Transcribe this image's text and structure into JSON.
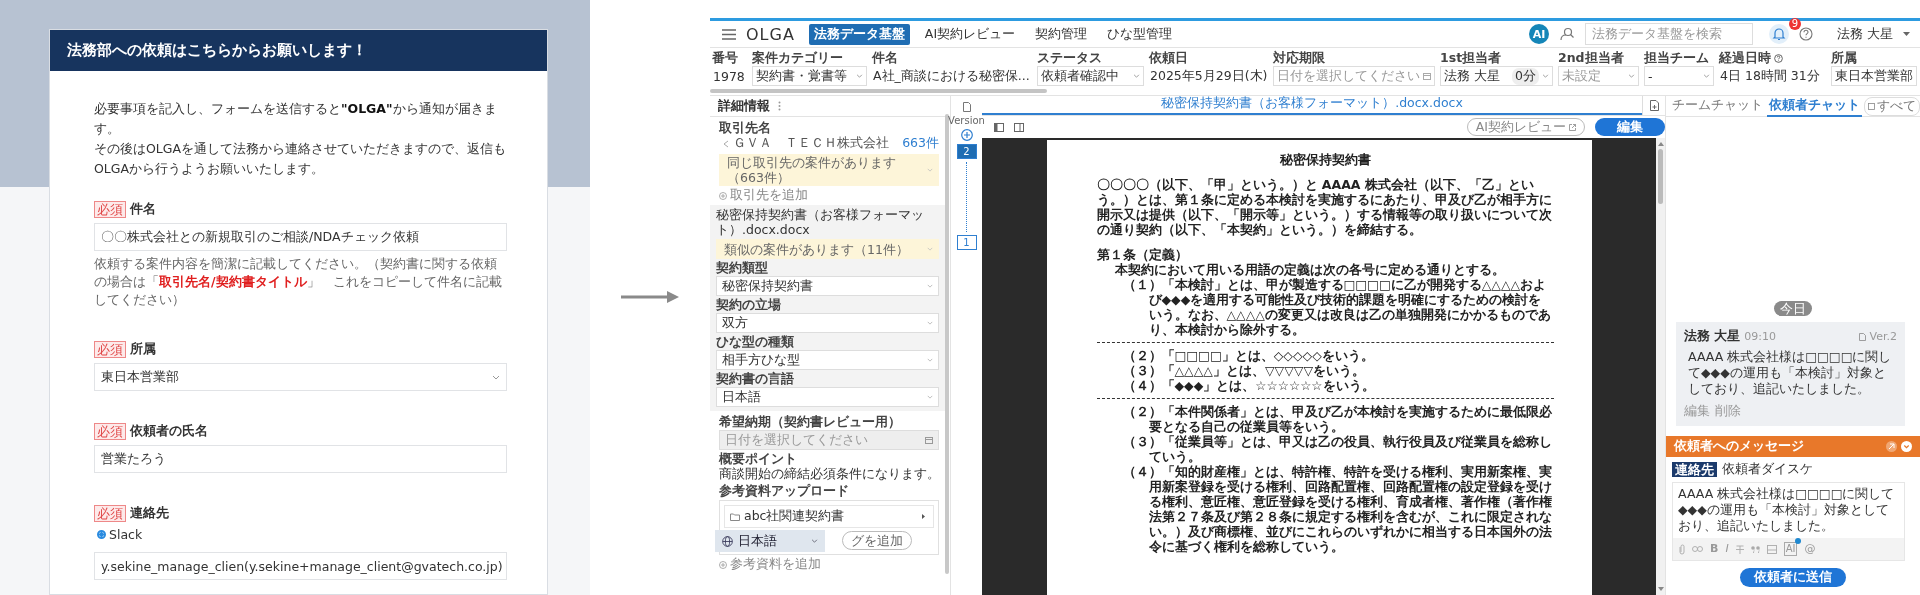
{
  "form": {
    "title": "法務部への依頼はこちらからお願いします！",
    "intro": [
      "必要事項を記入し、フォームを送信すると**\"OLGA\"**から通知が届きます。",
      "その後はOLGAを通して法務から連絡させていただきますので、返信もOLGAから行うようお願いいたします。"
    ],
    "fields": [
      {
        "kind": "text",
        "badge": "必須",
        "label": "件名",
        "value": "〇〇株式会社との新規取引のご相談/NDAチェック依頼",
        "help": "依頼する案件内容を簡潔に記載してください。（契約書に関する依頼の場合は「**取引先名/契約書タイトル**」　これをコピーして件名に記載してください）"
      },
      {
        "kind": "select",
        "badge": "必須",
        "label": "所属",
        "value": "東日本営業部"
      },
      {
        "kind": "text",
        "badge": "必須",
        "label": "依頼者の氏名",
        "value": "営業たろう"
      },
      {
        "kind": "select",
        "badge": "必須",
        "label": "連絡先",
        "options": [
          {
            "label": "Slack",
            "selected": true
          }
        ],
        "value": "y.sekine_manage_clien(y.sekine+manage_client@gvatech.co.jp)"
      }
    ]
  },
  "app": {
    "logo": "OLGA",
    "nav_tabs": [
      {
        "label": "法務データ基盤",
        "selected": true
      },
      {
        "label": "AI契約レビュー",
        "selected": false
      },
      {
        "label": "契約管理",
        "selected": false
      },
      {
        "label": "ひな型管理",
        "selected": false
      }
    ],
    "ai_badge": "AI",
    "search": {
      "placeholder": "法務データ基盤を検索"
    },
    "notification_count": "9",
    "user": "法務 大星",
    "meta_fields": [
      {
        "kind": "plain",
        "label": "番号",
        "value": "1978"
      },
      {
        "kind": "select",
        "label": "案件カテゴリー",
        "value": "契約書・覚書等"
      },
      {
        "kind": "plain",
        "label": "件名",
        "value": "A社_商談における秘密保..."
      },
      {
        "kind": "select",
        "label": "ステータス",
        "value": "依頼者確認中"
      },
      {
        "kind": "plain",
        "label": "依頼日",
        "value": "2025年5月29日(木)"
      },
      {
        "kind": "date",
        "label": "対応期限",
        "placeholder": "日付を選択してください"
      },
      {
        "kind": "assignee",
        "label": "1st担当者",
        "value": "法務 大星",
        "tag": "0分"
      },
      {
        "kind": "select",
        "label": "2nd担当者",
        "placeholder": "未設定"
      },
      {
        "kind": "select",
        "label": "担当チーム",
        "value": "-"
      },
      {
        "kind": "elapsed",
        "label": "経過日時",
        "value": "4日 18時間 31分"
      },
      {
        "kind": "box",
        "label": "所属",
        "value": "東日本営業部"
      }
    ],
    "details": {
      "title": "詳細情報",
      "partner_label": "取引先名",
      "partner": "ＧＶＡ　ＴＥＣＨ株式会社",
      "partner_count": "663件",
      "partner_notice": "同じ取引先の案件があります（663件）",
      "add_partner": "取引先を追加",
      "document_title": "秘密保持契約書（お客様フォーマット）.docx.docx",
      "similar_notice": "類似の案件があります（11件）",
      "selects": [
        {
          "label": "契約類型",
          "value": "秘密保持契約書"
        },
        {
          "label": "契約の立場",
          "value": "双方"
        },
        {
          "label": "ひな型の種類",
          "value": "相手方ひな型"
        },
        {
          "label": "契約書の言語",
          "value": "日本語"
        }
      ],
      "due_label": "希望納期（契約書レビュー用）",
      "due_placeholder": "日付を選択してください",
      "summary_label": "概要ポイント",
      "summary": "商談開始の締結必須条件になります。",
      "upload_label": "参考資料アップロード",
      "folder": "abc社関連契約書",
      "tag_button": "グを追加",
      "add_material": "参考資料を追加"
    },
    "language": "日本語",
    "versions_label": "Version",
    "versions": [
      {
        "label": "2",
        "selected": true
      },
      {
        "label": "1",
        "selected": false
      }
    ],
    "document": {
      "tab_title": "秘密保持契約書（お客様フォーマット）.docx.docx",
      "ai_review_button": "AI契約レビュー",
      "edit_button": "編集",
      "blocks": [
        {
          "kind": "title",
          "text": "秘密保持契約書"
        },
        {
          "kind": "para",
          "text": "〇〇〇〇（以下、「甲」という。）と AAAA 株式会社（以下、「乙」という。）とは、第１条に定める本検討を実施するにあたり、甲及び乙が相手方に開示又は提供（以下、「開示等」という。）する情報等の取り扱いについて次の通り契約（以下、「本契約」という。）を締結する。"
        },
        {
          "kind": "heading",
          "text": "第１条（定義）"
        },
        {
          "kind": "lead",
          "text": "本契約において用いる用語の定義は次の各号に定める通りとする。"
        },
        {
          "kind": "item",
          "text": "（１）「本検討」とは、甲が製造する□□□□に乙が開発する△△△△および◆◆◆を適用する可能性及び技術的課題を明確にするための検討をいう。なお、△△△△の変更又は改良は乙の単独開発にかかるものであり、本検討から除外する。"
        },
        {
          "kind": "rule"
        },
        {
          "kind": "item",
          "text": "（２）「□□□□」とは、◇◇◇◇◇をいう。"
        },
        {
          "kind": "item",
          "text": "（３）「△△△△」とは、▽▽▽▽▽をいう。"
        },
        {
          "kind": "item",
          "text": "（４）「◆◆◆」とは、☆☆☆☆☆☆をいう。"
        },
        {
          "kind": "rule"
        },
        {
          "kind": "item",
          "text": "（２）「本件関係者」とは、甲及び乙が本検討を実施するために最低限必要となる自己の従業員等をいう。"
        },
        {
          "kind": "item",
          "text": "（３）「従業員等」とは、甲又は乙の役員、執行役員及び従業員を総称していう。"
        },
        {
          "kind": "item",
          "text": "（４）「知的財産権」とは、特許権、特許を受ける権利、実用新案権、実用新案登録を受ける権利、回路配置権、回路配置権の設定登録を受ける権利、意匠権、意匠登録を受ける権利、育成者権、著作権（著作権法第２７条及び第２８条に規定する権利を含むが、これに限定されない。）及び商標権、並びにこれらのいずれかに相当する日本国外の法令に基づく権利を総称していう。"
        }
      ]
    },
    "chat": {
      "tabs": [
        {
          "label": "チームチャット",
          "selected": false
        },
        {
          "label": "依頼者チャット",
          "selected": true
        }
      ],
      "all_button": "すべて",
      "date_chip": "今日",
      "messages": [
        {
          "author": "法務 大星",
          "time": "09:10",
          "version": "Ver.2",
          "body": "AAAA 株式会社様は□□□□に関して◆◆◆の運用も「本検討」対象としており、追記いたしました。",
          "actions": [
            "編集",
            "削除"
          ]
        }
      ],
      "composer": {
        "title": "依頼者へのメッセージ",
        "recipient_tag": "連絡先",
        "recipient": "依頼者ダイスケ",
        "text": "AAAA 株式会社様は□□□□に関して◆◆◆の運用も「本検討」対象としており、追記いたしました。",
        "tools": [
          {
            "kind": "attach"
          },
          {
            "kind": "link"
          },
          {
            "kind": "bold",
            "glyph": "B"
          },
          {
            "kind": "italic",
            "glyph": "I"
          },
          {
            "kind": "strike"
          },
          {
            "kind": "quote"
          },
          {
            "kind": "image"
          },
          {
            "kind": "ai",
            "glyph": "AI"
          },
          {
            "kind": "mention",
            "glyph": "@"
          }
        ],
        "send_button": "依頼者に送信"
      }
    }
  }
}
